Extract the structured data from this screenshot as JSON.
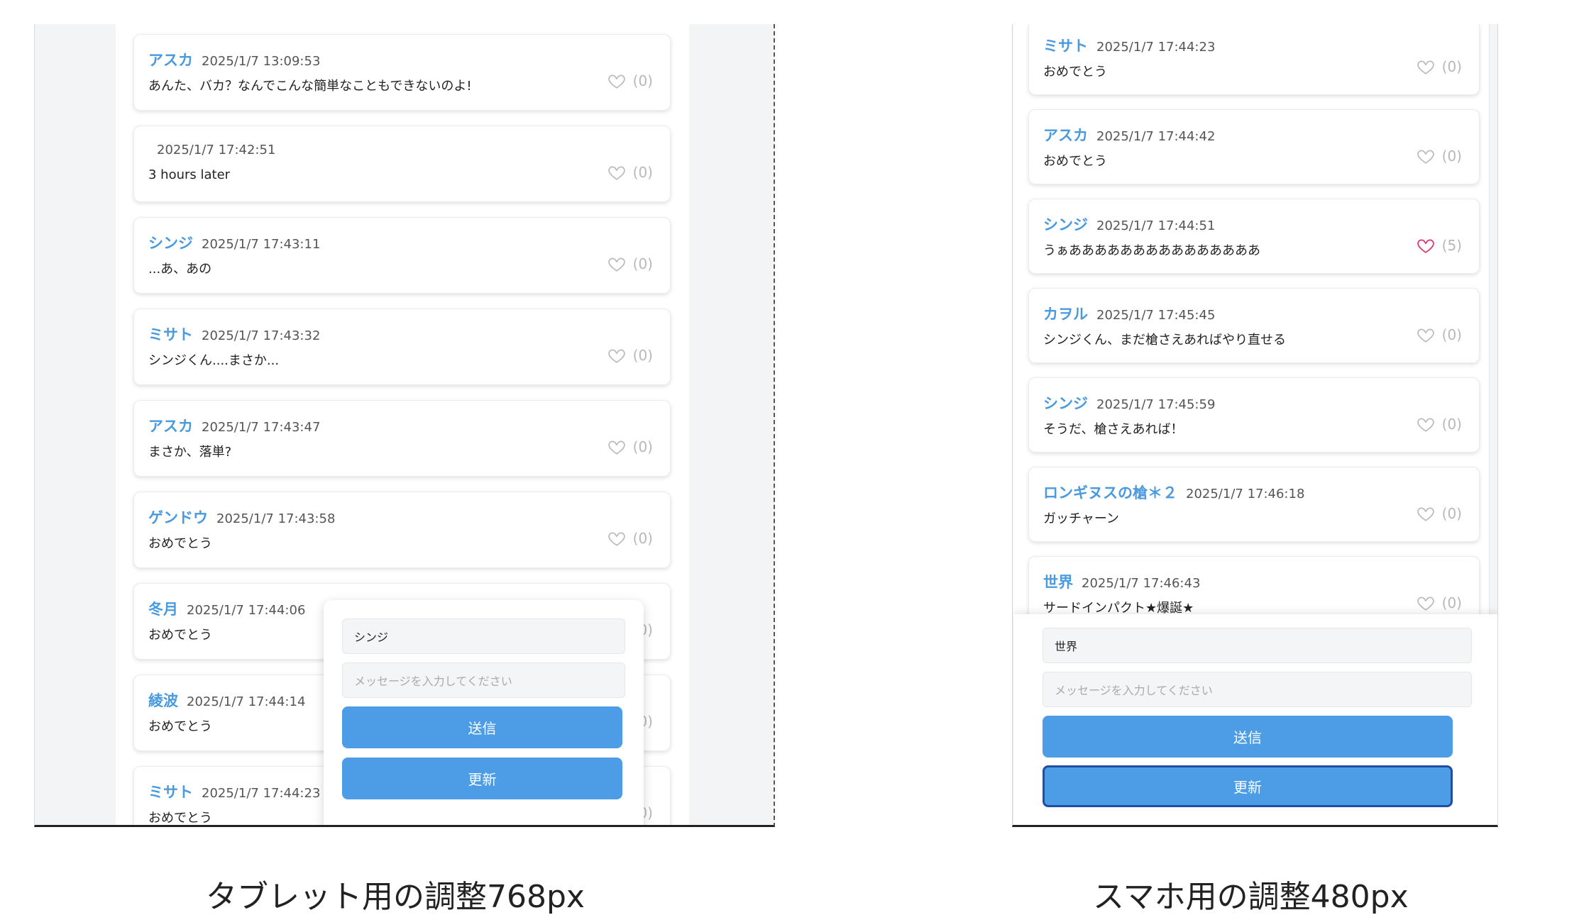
{
  "tablet": {
    "caption": "タブレット用の調整768px",
    "messages": [
      {
        "name": "アスカ",
        "time": "2025/1/7 13:09:53",
        "text": "あんた、バカ？なんでこんな簡単なこともできないのよ!",
        "likes": "(0)",
        "liked": false
      },
      {
        "name": "",
        "time": "2025/1/7 17:42:51",
        "text": "3 hours later",
        "likes": "(0)",
        "liked": false
      },
      {
        "name": "シンジ",
        "time": "2025/1/7 17:43:11",
        "text": "...あ、あの",
        "likes": "(0)",
        "liked": false
      },
      {
        "name": "ミサト",
        "time": "2025/1/7 17:43:32",
        "text": "シンジくん....まさか...",
        "likes": "(0)",
        "liked": false
      },
      {
        "name": "アスカ",
        "time": "2025/1/7 17:43:47",
        "text": "まさか、落単?",
        "likes": "(0)",
        "liked": false
      },
      {
        "name": "ゲンドウ",
        "time": "2025/1/7 17:43:58",
        "text": "おめでとう",
        "likes": "(0)",
        "liked": false
      },
      {
        "name": "冬月",
        "time": "2025/1/7 17:44:06",
        "text": "おめでとう",
        "likes": "(0)",
        "liked": false
      },
      {
        "name": "綾波",
        "time": "2025/1/7 17:44:14",
        "text": "おめでとう",
        "likes": "(0)",
        "liked": false
      },
      {
        "name": "ミサト",
        "time": "2025/1/7 17:44:23",
        "text": "おめでとう",
        "likes": "(0)",
        "liked": false
      }
    ],
    "form": {
      "name_value": "シンジ",
      "message_placeholder": "メッセージを入力してください",
      "send_label": "送信",
      "refresh_label": "更新"
    }
  },
  "phone": {
    "caption": "スマホ用の調整480px",
    "messages": [
      {
        "name": "ミサト",
        "time": "2025/1/7 17:44:23",
        "text": "おめでとう",
        "likes": "(0)",
        "liked": false
      },
      {
        "name": "アスカ",
        "time": "2025/1/7 17:44:42",
        "text": "おめでとう",
        "likes": "(0)",
        "liked": false
      },
      {
        "name": "シンジ",
        "time": "2025/1/7 17:44:51",
        "text": "うぁあああああああああああああああ",
        "likes": "(5)",
        "liked": true
      },
      {
        "name": "カヲル",
        "time": "2025/1/7 17:45:45",
        "text": "シンジくん、まだ槍さえあればやり直せる",
        "likes": "(0)",
        "liked": false
      },
      {
        "name": "シンジ",
        "time": "2025/1/7 17:45:59",
        "text": "そうだ、槍さえあれば！",
        "likes": "(0)",
        "liked": false
      },
      {
        "name": "ロンギヌスの槍＊２",
        "time": "2025/1/7 17:46:18",
        "text": "ガッチャーン",
        "likes": "(0)",
        "liked": false
      },
      {
        "name": "世界",
        "time": "2025/1/7 17:46:43",
        "text": "サードインパクト★爆誕★",
        "likes": "(0)",
        "liked": false
      }
    ],
    "form": {
      "name_value": "世界",
      "message_placeholder": "メッセージを入力してください",
      "send_label": "送信",
      "refresh_label": "更新"
    }
  },
  "colors": {
    "name": "#4a9ae0",
    "button": "#4d9ce6",
    "heart_liked": "#e0306a",
    "heart_default": "#bbbbbb"
  },
  "icons": {
    "like": "heart-icon"
  }
}
